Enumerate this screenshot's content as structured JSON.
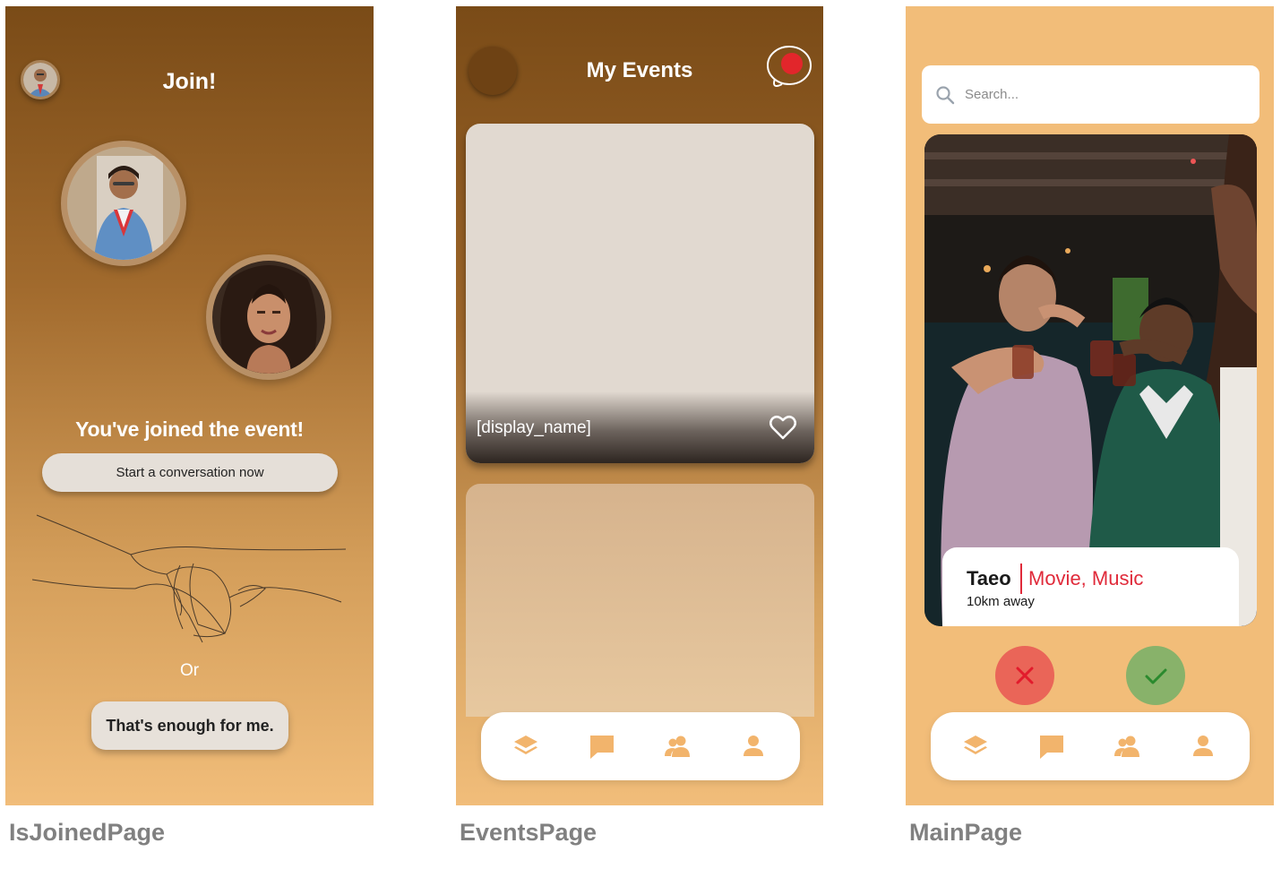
{
  "captions": {
    "joined": "IsJoinedPage",
    "events": "EventsPage",
    "main": "MainPage"
  },
  "joined_page": {
    "title": "Join!",
    "joined_message": "You've joined the event!",
    "start_conversation_label": "Start  a conversation   now",
    "or_label": "Or",
    "enough_label": "That's enough for me."
  },
  "events_page": {
    "title": "My Events",
    "event_card": {
      "display_name": "[display_name]"
    },
    "nav_items": [
      "layers-icon",
      "chat-icon",
      "group-icon",
      "person-icon"
    ]
  },
  "main_page": {
    "search_placeholder": "Search...",
    "profile": {
      "name": "Taeo",
      "interests": "Movie, Music",
      "distance": "10km away"
    },
    "nav_items": [
      "layers-icon",
      "chat-icon",
      "group-icon",
      "person-icon"
    ]
  },
  "colors": {
    "nav_icon": "#f2b46c",
    "reject": "#ea6558",
    "accept": "#88b26a",
    "interest_accent": "#e02a3a"
  }
}
